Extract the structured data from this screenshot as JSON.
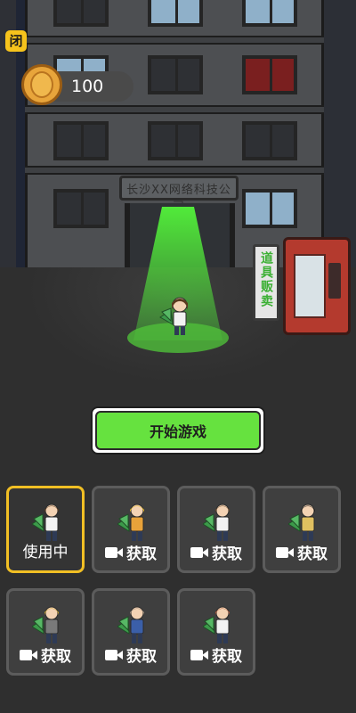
{
  "hud": {
    "pause_glyph": "闭",
    "coins": "100"
  },
  "building": {
    "sign_text": "长沙XX网络科技公司"
  },
  "vending": {
    "label": "道具贩卖"
  },
  "start_button": {
    "label": "开始游戏"
  },
  "characters": [
    {
      "status": "使用中",
      "active": true,
      "hair": "#5a3a1e",
      "shirt": "#f2f2f2"
    },
    {
      "status": "获取",
      "active": false,
      "hair": "#f0c21c",
      "shirt": "#e8a23a"
    },
    {
      "status": "获取",
      "active": false,
      "hair": "#6b4a2b",
      "shirt": "#f2f2f2"
    },
    {
      "status": "获取",
      "active": false,
      "hair": "#1e1e1e",
      "shirt": "#e0c060"
    },
    {
      "status": "获取",
      "active": false,
      "hair": "#c9a42c",
      "shirt": "#7a7a7a"
    },
    {
      "status": "获取",
      "active": false,
      "hair": "#9a8a7a",
      "shirt": "#3b5fa8"
    },
    {
      "status": "获取",
      "active": false,
      "hair": "#b05b3b",
      "shirt": "#f2f2f2"
    }
  ],
  "colors": {
    "accent_green": "#66e23f",
    "selected_border": "#f1bf24",
    "coin": "#e8a53b"
  }
}
